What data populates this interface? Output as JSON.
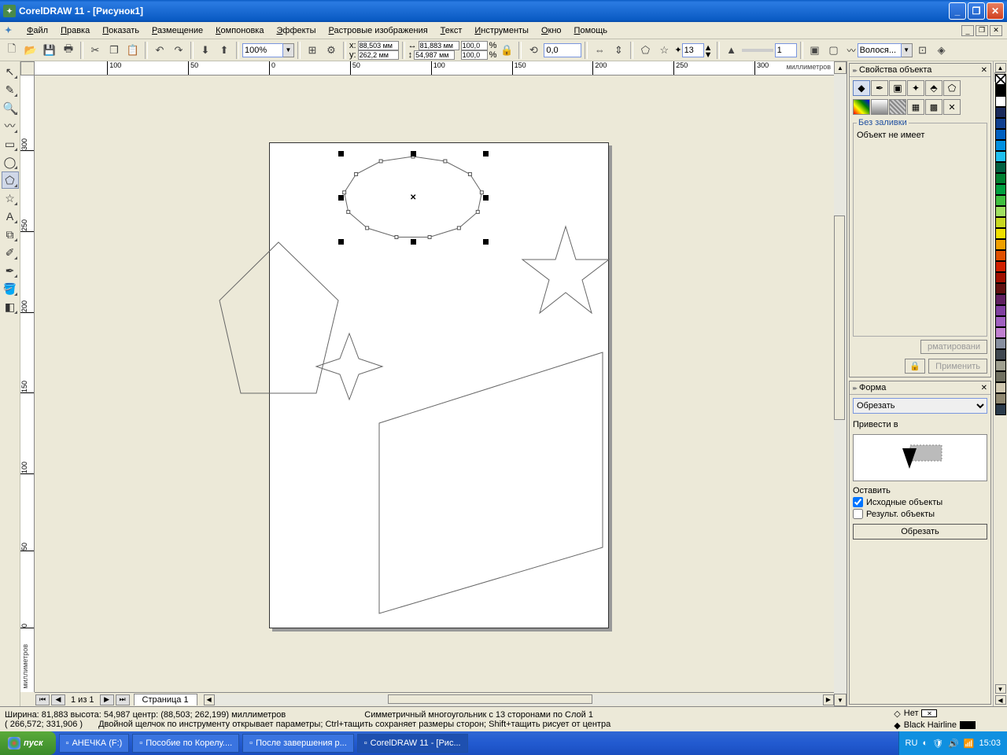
{
  "title": "CorelDRAW 11 - [Рисунок1]",
  "menu": [
    "Файл",
    "Правка",
    "Показать",
    "Размещение",
    "Компоновка",
    "Эффекты",
    "Растровые изображения",
    "Текст",
    "Инструменты",
    "Окно",
    "Помощь"
  ],
  "propbar": {
    "zoom": "100%",
    "x": "88,503 мм",
    "y": "262,2 мм",
    "w": "81,883 мм",
    "h": "54,987 мм",
    "scale_x": "100,0",
    "scale_y": "100,0",
    "scale_unit": "%",
    "rotation": "0,0",
    "sides": "13",
    "outline_pt": "1",
    "font_combo": "Волося..."
  },
  "rulers": {
    "h_ticks": [
      -100,
      -50,
      0,
      50,
      100,
      150,
      200,
      250,
      300
    ],
    "v_ticks": [
      0,
      50,
      100,
      150,
      200,
      250,
      300
    ],
    "unit": "миллиметров"
  },
  "page_nav": {
    "counter": "1 из 1",
    "tab": "Страница 1"
  },
  "status": {
    "line1_a": "Ширина: 81,883  высота: 54,987  центр: (88,503; 262,199)  миллиметров",
    "line1_b": "Симметричный многоугольник с 13 сторонами по Слой 1",
    "line2_a": "( 266,572; 331,906 )",
    "line2_b": "Двойной щелчок по инструменту открывает параметры; Ctrl+тащить сохраняет размеры сторон; Shift+тащить рисует от центра",
    "fill": "Нет",
    "outline": "Black  Hairline"
  },
  "docker_props": {
    "title": "Свойства объекта",
    "no_fill_legend": "Без заливки",
    "no_fill_text": "Объект не имеет",
    "btn_format": "рматировани",
    "btn_apply": "Применить"
  },
  "docker_shape": {
    "title": "Форма",
    "combo": "Обрезать",
    "lead_label": "Привести в",
    "keep_label": "Оставить",
    "chk_source": "Исходные объекты",
    "chk_result": "Результ. объекты",
    "btn_trim": "Обрезать"
  },
  "taskbar": {
    "start": "пуск",
    "items": [
      "АНЕЧКА (F:)",
      "Пособие по Корелу....",
      "После завершения р...",
      "CorelDRAW 11 - [Рис..."
    ],
    "lang": "RU",
    "time": "15:03"
  },
  "palette": [
    "none",
    "#000000",
    "#ffffff",
    "#1a2a5a",
    "#104090",
    "#0060c0",
    "#0090e0",
    "#20c0f0",
    "#006040",
    "#008030",
    "#00a040",
    "#40c040",
    "#a0e060",
    "#c8d820",
    "#f0e000",
    "#f0a000",
    "#e05000",
    "#d02000",
    "#a01000",
    "#601010",
    "#602060",
    "#8040a0",
    "#a060c0",
    "#c080d0",
    "#8890a0",
    "#404850",
    "#a0a090",
    "#707060",
    "#d0c8b0",
    "#908870",
    "#2a3a4a"
  ]
}
